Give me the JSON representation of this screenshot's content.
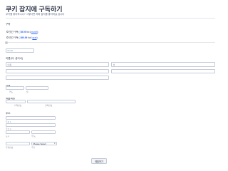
{
  "header": {
    "title": "쿠키 잡지에 구독하기",
    "subtitle": "쿠키를 좋아하시나? 그렇다면 저희 잡지를 좋아하실 겁니다"
  },
  "plan": {
    "label": "구독",
    "options": [
      {
        "prefix": "월간 구독 (",
        "price": "$9.99",
        "suffix": " for ",
        "unit": "1",
        "link": "month"
      },
      {
        "prefix": "연간 구독 (",
        "price": "$99.99",
        "suffix": " for ",
        "unit": "1",
        "link": "year"
      }
    ],
    "slider_value": 0,
    "slider_ticks": [
      "",
      ""
    ]
  },
  "email": {
    "placeholder": "Email"
  },
  "name": {
    "label": "이름(이: 성이나)",
    "first_placeholder": "이름",
    "last_placeholder": "성"
  },
  "birthdate": {
    "label": "더불",
    "sub_1": "연도",
    "sub_2": "월"
  },
  "phone": {
    "label": "전화번호",
    "sub_1": "지역번호",
    "sub_2": "전화번호"
  },
  "address": {
    "label": "주소",
    "sub_street": "주소 1",
    "sub_street2": "주소 2",
    "sub_city": "도시",
    "sub_state": "주/도",
    "sub_zip": "우편번호",
    "country_value": "Please Select",
    "sub_country": "국가"
  },
  "submit_label": "제출하기"
}
